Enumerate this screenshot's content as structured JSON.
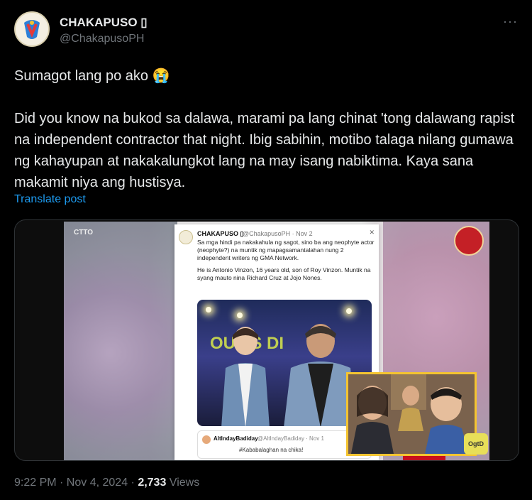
{
  "author": {
    "name": "CHAKAPUSO",
    "badge_glyph": "▯",
    "handle": "@ChakapusoPH"
  },
  "more_label": "···",
  "post": {
    "paragraph1": "Sumagot lang po ako 😭",
    "paragraph2": "Did you know na bukod sa dalawa, marami pa lang chinat 'tong dalawang rapist na independent contractor that night. Ibig sabihin, motibo talaga nilang gumawa ng kahayupan at nakakalungkot lang na may isang nabiktima. Kaya sana makamit niya ang hustisya."
  },
  "translate_label": "Translate post",
  "media": {
    "ctto": "CTTO",
    "card": {
      "name": "CHAKAPUSO ▯",
      "handle": "@ChakapusoPH · Nov 2",
      "close": "✕",
      "text1": "Sa mga hindi pa nakakahula ng sagot, sino ba ang neophyte actor (neophyte?) na muntik ng mapagsamantalahan nung 2 independent writers ng GMA Network.",
      "text2": "He is Antonio Vinzon, 16 years old, son of Roy Vinzon. Muntik na syang mauto nina Richard Cruz at Jojo Nones.",
      "photo_text": "OUT S  DI"
    },
    "quote": {
      "name": "AltIndayBadiday",
      "handle": "@AltIndayBadiday · Nov 1",
      "text": "#Kababalaghan na chika!"
    },
    "ogtd_label": "OgtD"
  },
  "footer": {
    "time": "9:22 PM · Nov 4, 2024 · ",
    "views_count": "2,733",
    "views_label": " Views"
  },
  "colors": {
    "background": "#000000",
    "text": "#e7e9ea",
    "muted": "#71767b",
    "link": "#1d9bf0"
  }
}
